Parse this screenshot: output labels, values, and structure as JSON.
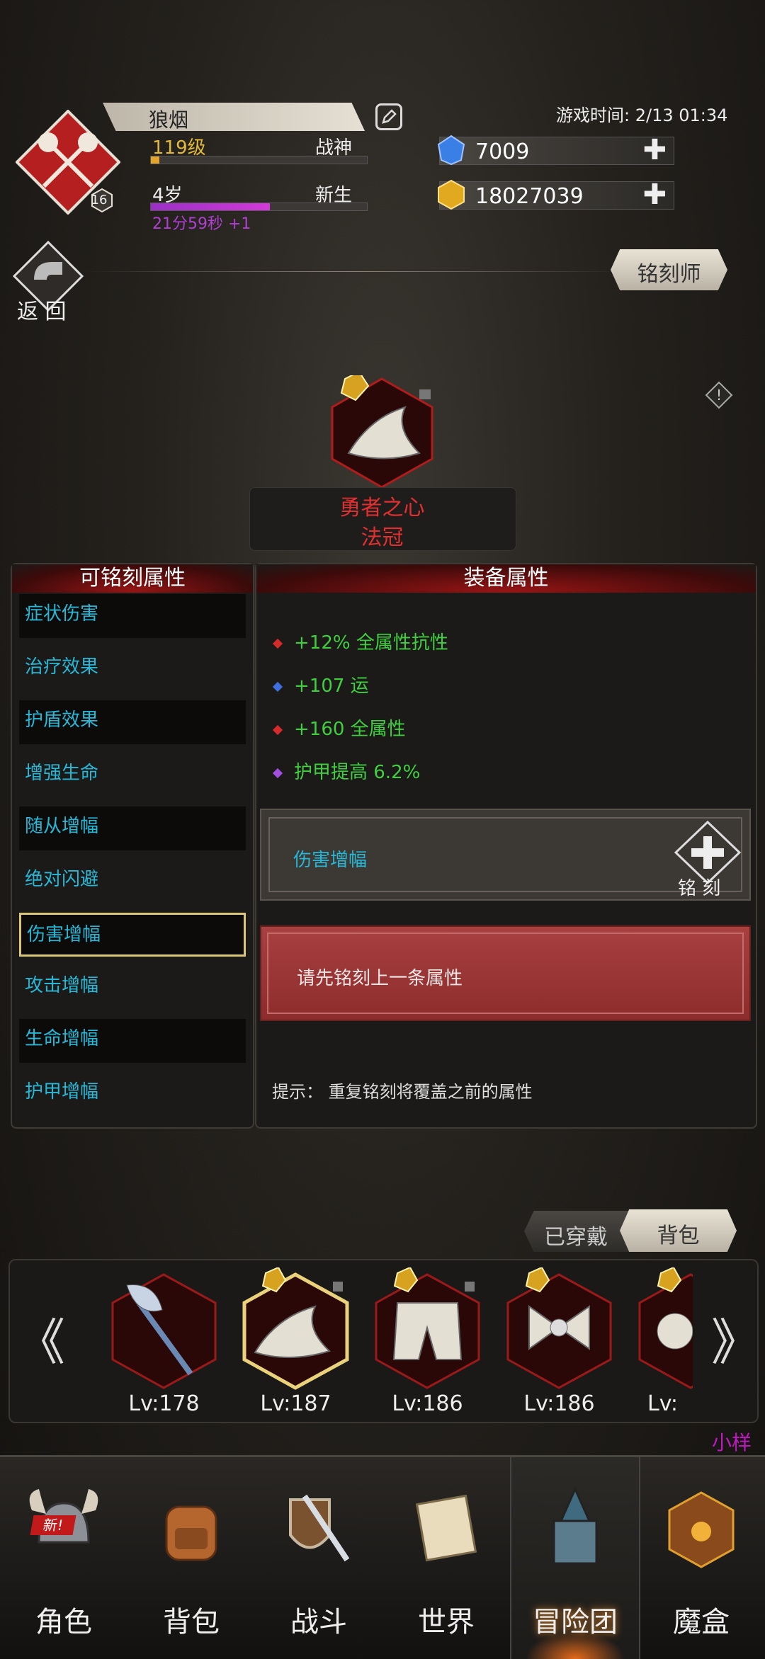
{
  "player": {
    "name": "狼烟",
    "level": "119级",
    "title": "战神",
    "age": "4岁",
    "age_title": "新生",
    "timer": "21分59秒 +1",
    "crest_level": "16",
    "level_progress": 0.04,
    "age_progress": 0.55
  },
  "header": {
    "game_time": "游戏时间: 2/13 01:34",
    "diamonds": "7009",
    "gold": "18027039",
    "back_label": "返 回",
    "engraver_label": "铭刻师"
  },
  "item": {
    "name": "勇者之心",
    "type": "法冠"
  },
  "left_panel": {
    "title": "可铭刻属性",
    "attributes": [
      "症状伤害",
      "治疗效果",
      "护盾效果",
      "增强生命",
      "随从增幅",
      "绝对闪避",
      "伤害增幅",
      "攻击增幅",
      "生命增幅",
      "护甲增幅"
    ]
  },
  "right_panel": {
    "title": "装备属性",
    "stats": [
      {
        "text": "+12% 全属性抗性",
        "color": "#d62b2b"
      },
      {
        "text": "+107 运",
        "color": "#3f6fe0"
      },
      {
        "text": "+160 全属性",
        "color": "#d62b2b"
      },
      {
        "text": "护甲提高 6.2%",
        "color": "#a24fe0"
      }
    ],
    "slot1_label": "伤害增幅",
    "engrave_button": "铭 刻",
    "slot2_label": "请先铭刻上一条属性",
    "hint": "提示：  重复铭刻将覆盖之前的属性"
  },
  "tabs": {
    "worn": "已穿戴",
    "bag": "背包"
  },
  "inventory": [
    {
      "level": "Lv:178",
      "icon": "battle-axe-icon"
    },
    {
      "level": "Lv:187",
      "icon": "wizard-hat-icon"
    },
    {
      "level": "Lv:186",
      "icon": "pants-icon"
    },
    {
      "level": "Lv:186",
      "icon": "bow-ribbon-icon"
    },
    {
      "level": "Lv:",
      "icon": "partial-item-icon"
    }
  ],
  "watermark_user": "小样",
  "nav": [
    {
      "label": "角色",
      "icon": "helmet-icon",
      "badge": "新!"
    },
    {
      "label": "背包",
      "icon": "backpack-icon"
    },
    {
      "label": "战斗",
      "icon": "sword-shield-icon"
    },
    {
      "label": "世界",
      "icon": "scroll-map-icon"
    },
    {
      "label": "冒险团",
      "icon": "castle-icon"
    },
    {
      "label": "魔盒",
      "icon": "magic-box-icon"
    }
  ],
  "colors": {
    "accent_red": "#e23030",
    "cyan_text": "#27b8d8",
    "green_text": "#3fcf3f",
    "gold": "#e3b93b"
  }
}
